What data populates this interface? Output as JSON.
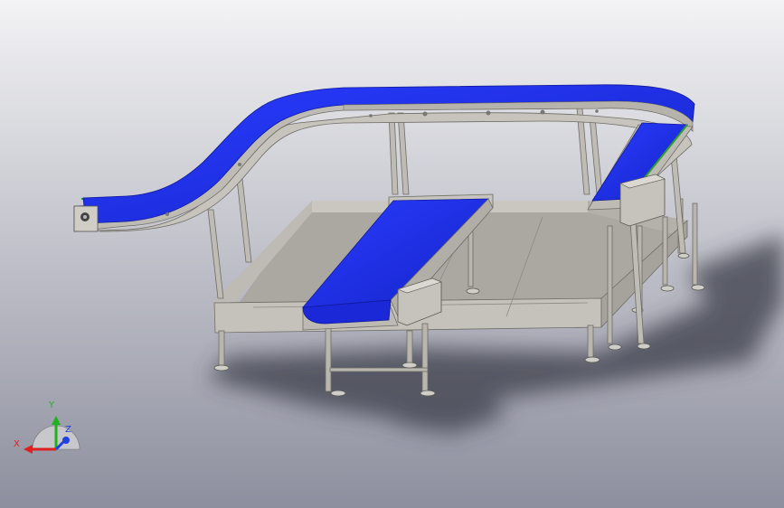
{
  "viewport": {
    "background_top": "#f3f3f5",
    "background_bottom": "#8d8f9e"
  },
  "colors": {
    "belt": "#1f2ff0",
    "belt_dark": "#101a9a",
    "belt_edge_green": "#2aa02a",
    "frame": "#bdbbb3",
    "frame_dark": "#8e8c84",
    "tray": "#b8b6ae",
    "tray_floor": "#a9a7a0",
    "shadow": "#3a3c4a"
  },
  "triad": {
    "x_label": "X",
    "y_label": "Y",
    "z_label": "Z",
    "x_color": "#e02020",
    "y_color": "#20b020",
    "z_color": "#2040e0"
  }
}
